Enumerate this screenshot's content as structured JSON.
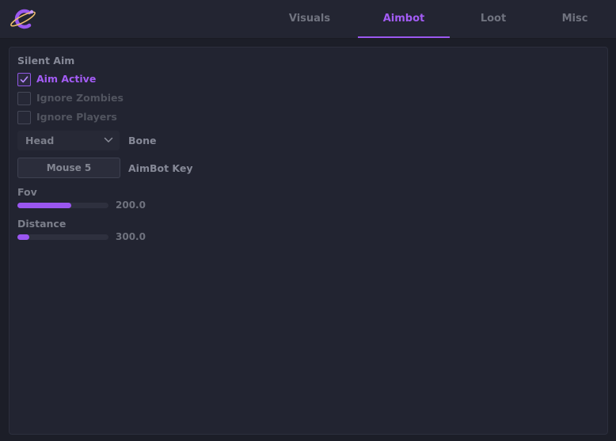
{
  "tabs": [
    {
      "label": "Visuals",
      "active": false
    },
    {
      "label": "Aimbot",
      "active": true
    },
    {
      "label": "Loot",
      "active": false
    },
    {
      "label": "Misc",
      "active": false
    }
  ],
  "section": {
    "title": "Silent Aim"
  },
  "checkboxes": [
    {
      "label": "Aim Active",
      "checked": true
    },
    {
      "label": "Ignore Zombies",
      "checked": false
    },
    {
      "label": "Ignore Players",
      "checked": false
    }
  ],
  "bone": {
    "value": "Head",
    "label": "Bone"
  },
  "aimbot_key": {
    "value": "Mouse 5",
    "label": "AimBot Key"
  },
  "sliders": [
    {
      "label": "Fov",
      "value_text": "200.0",
      "fill_fraction": 0.59
    },
    {
      "label": "Distance",
      "value_text": "300.0",
      "fill_fraction": 0.13
    }
  ],
  "colors": {
    "accent": "#9b58f0",
    "background": "#1c1e28",
    "panel": "#222431"
  },
  "icons": {
    "logo": "planet-logo-icon",
    "check": "check-icon",
    "dropdown": "chevron-down-icon"
  }
}
